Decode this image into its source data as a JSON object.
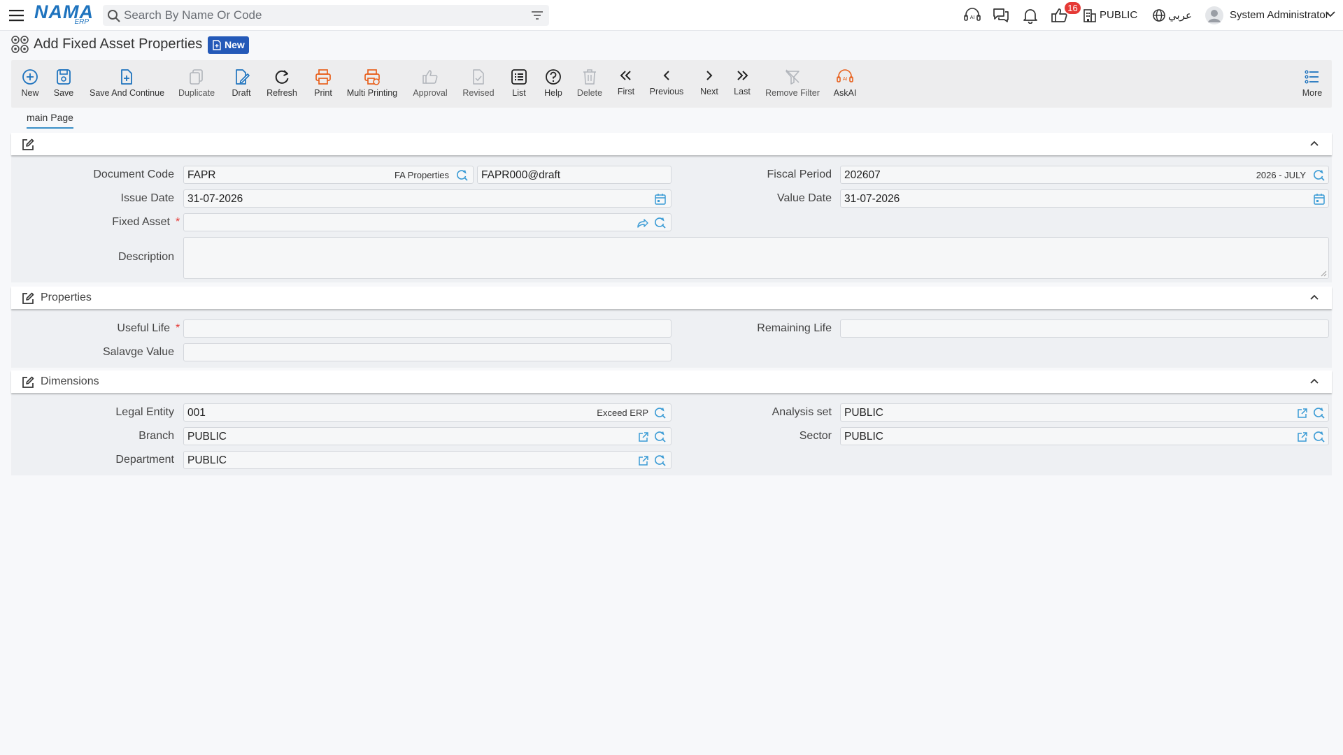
{
  "header": {
    "logo_text": "NAMA",
    "logo_sub": "ERP",
    "search_placeholder": "Search By Name Or Code",
    "notification_count": "16",
    "company": "PUBLIC",
    "language": "عربي",
    "user": "System Administrator"
  },
  "page": {
    "title": "Add Fixed Asset Properties",
    "status_badge": "New"
  },
  "toolbar": {
    "new": "New",
    "save": "Save",
    "save_continue": "Save And Continue",
    "duplicate": "Duplicate",
    "draft": "Draft",
    "refresh": "Refresh",
    "print": "Print",
    "multi_printing": "Multi Printing",
    "approval": "Approval",
    "revised": "Revised",
    "list": "List",
    "help": "Help",
    "delete": "Delete",
    "first": "First",
    "previous": "Previous",
    "next": "Next",
    "last": "Last",
    "remove_filter": "Remove Filter",
    "askai": "AskAI",
    "more": "More"
  },
  "tabs": [
    "main Page"
  ],
  "main_section": {
    "document_code_label": "Document Code",
    "document_code": "FAPR",
    "document_code_name": "FA Properties",
    "document_number": "FAPR000@draft",
    "issue_date_label": "Issue Date",
    "issue_date": "31-07-2026",
    "fixed_asset_label": "Fixed Asset",
    "fixed_asset": "",
    "description_label": "Description",
    "description": "",
    "fiscal_period_label": "Fiscal Period",
    "fiscal_period": "202607",
    "fiscal_period_name": "2026 - JULY",
    "value_date_label": "Value Date",
    "value_date": "31-07-2026",
    "required_mark": "*"
  },
  "properties_section": {
    "title": "Properties",
    "useful_life_label": "Useful Life",
    "useful_life": "",
    "salvage_value_label": "Salavge Value",
    "salvage_value": "",
    "remaining_life_label": "Remaining Life",
    "remaining_life": ""
  },
  "dimensions_section": {
    "title": "Dimensions",
    "legal_entity_label": "Legal Entity",
    "legal_entity": "001",
    "legal_entity_name": "Exceed ERP",
    "branch_label": "Branch",
    "branch": "PUBLIC",
    "department_label": "Department",
    "department": "PUBLIC",
    "analysis_set_label": "Analysis set",
    "analysis_set": "PUBLIC",
    "sector_label": "Sector",
    "sector": "PUBLIC"
  },
  "colors": {
    "accent": "#1e73be",
    "badge": "#2459b8",
    "print_orange": "#e8601c",
    "required": "#e53935"
  }
}
